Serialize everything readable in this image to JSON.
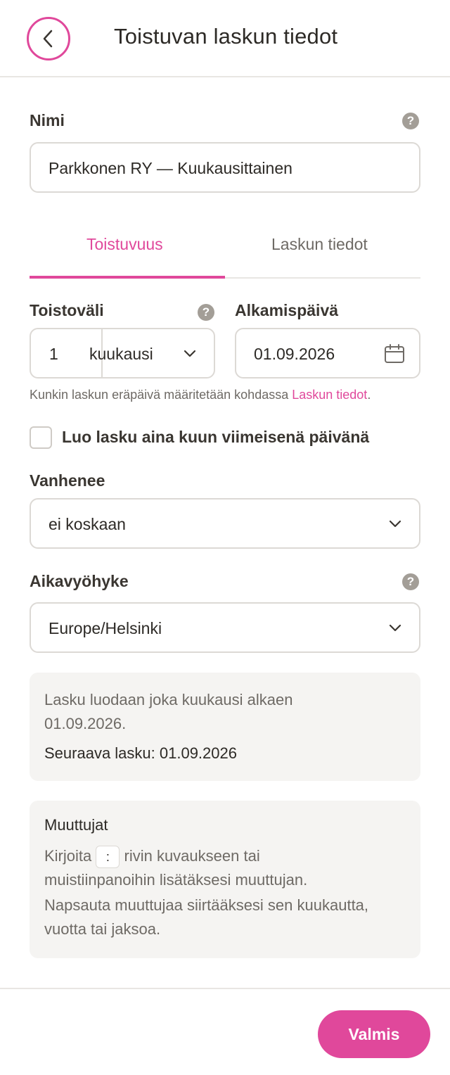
{
  "header": {
    "title": "Toistuvan laskun tiedot",
    "back_icon": "chevron-left-icon"
  },
  "name": {
    "label": "Nimi",
    "value": "Parkkonen RY — Kuukausittainen"
  },
  "tabs": [
    {
      "label": "Toistuvuus",
      "active": true
    },
    {
      "label": "Laskun tiedot",
      "active": false
    }
  ],
  "interval": {
    "label": "Toistoväli",
    "count": "1",
    "unit": "kuukausi"
  },
  "start_date": {
    "label": "Alkamispäivä",
    "value": "01.09.2026"
  },
  "hint": {
    "text": "Kunkin laskun eräpäivä määritetään kohdassa ",
    "link": "Laskun tiedot",
    "end": "."
  },
  "last_day": {
    "label": "Luo lasku aina kuun viimeisenä päivänä",
    "checked": false
  },
  "expires": {
    "label": "Vanhenee",
    "value": "ei koskaan"
  },
  "timezone": {
    "label": "Aikavyöhyke",
    "value": "Europe/Helsinki"
  },
  "summary": {
    "line1": "Lasku luodaan joka kuukausi alkaen",
    "line2": "01.09.2026.",
    "next": "Seuraava lasku: 01.09.2026"
  },
  "variables": {
    "title": "Muuttujat",
    "line1_pre": "Kirjoita",
    "key": ":",
    "line1_post": "rivin kuvaukseen tai",
    "line2": "muistiinpanoihin lisätäksesi muuttujan.",
    "line3": "Napsauta muuttujaa siirtääksesi sen kuukautta,",
    "line4": "vuotta tai jaksoa."
  },
  "footer": {
    "done_label": "Valmis"
  },
  "colors": {
    "accent": "#e0489b",
    "border": "#dcd9d5",
    "muted": "#6e6a65",
    "panel": "#f5f4f2"
  }
}
